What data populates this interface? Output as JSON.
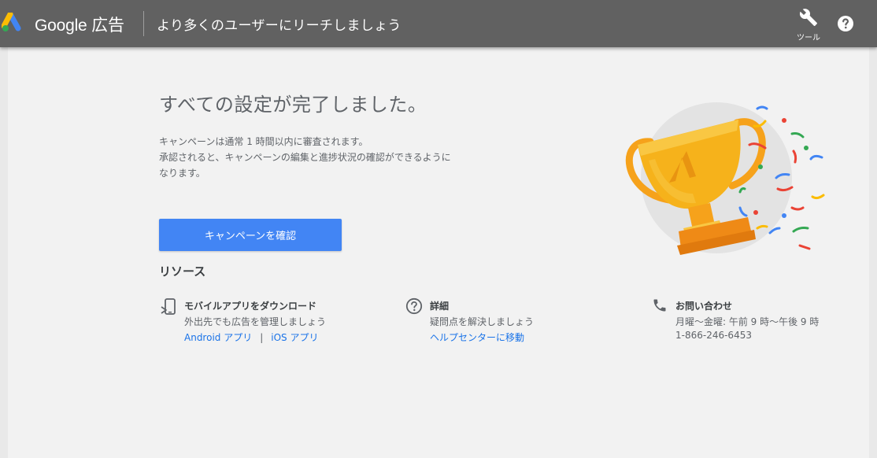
{
  "header": {
    "brand": "Google 広告",
    "tagline": "より多くのユーザーにリーチしましょう",
    "tools_label": "ツール",
    "help_icon": "help-icon",
    "tools_icon": "wrench-icon"
  },
  "main": {
    "title": "すべての設定が完了しました。",
    "description_line1": "キャンペーンは通常 1 時間以内に審査されます。",
    "description_line2": "承認されると、キャンペーンの編集と進捗状況の確認ができるように",
    "description_line3": "なります。",
    "primary_button": "キャンペーンを確認"
  },
  "resources": {
    "title": "リソース",
    "mobile": {
      "icon": "mobile-app-icon",
      "title": "モバイルアプリをダウンロード",
      "subtitle": "外出先でも広告を管理しましょう",
      "android_link": "Android アプリ",
      "separator": "|",
      "ios_link": "iOS アプリ"
    },
    "details": {
      "icon": "help-circle-icon",
      "title": "詳細",
      "subtitle": "疑問点を解決しましょう",
      "link": "ヘルプセンターに移動"
    },
    "contact": {
      "icon": "phone-icon",
      "title": "お問い合わせ",
      "hours": "月曜〜金曜: 午前 9 時〜午後 9 時",
      "phone": "1-866-246-6453"
    }
  },
  "colors": {
    "topbar": "#616161",
    "primary": "#4285f4",
    "link": "#1a73e8",
    "trophy_gold": "#f6b21b"
  }
}
